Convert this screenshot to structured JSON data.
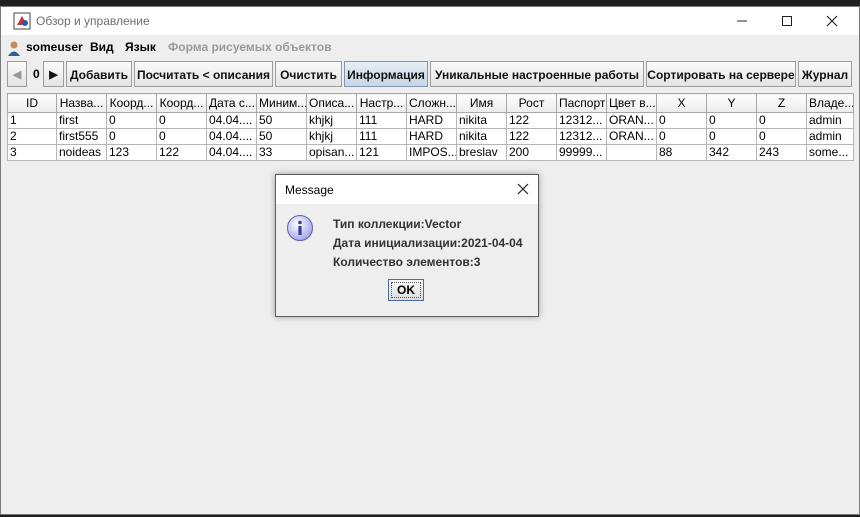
{
  "window": {
    "title": "Обзор и управление"
  },
  "menubar": {
    "user": "someuser",
    "view": "Вид",
    "language": "Язык",
    "shapes_form": "Форма рисуемых объектов"
  },
  "toolbar": {
    "page": "0",
    "add": "Добавить",
    "count": "Посчитать < описания",
    "clear": "Очистить",
    "info": "Информация",
    "unique": "Уникальные настроенные работы",
    "sort": "Сортировать на сервере",
    "log": "Журнал"
  },
  "table": {
    "headers": [
      "ID",
      "Назва...",
      "Коорд...",
      "Коорд...",
      "Дата с...",
      "Миним...",
      "Описа...",
      "Настр...",
      "Сложн...",
      "Имя",
      "Рост",
      "Паспорт",
      "Цвет в...",
      "X",
      "Y",
      "Z",
      "Владе..."
    ],
    "rows": [
      [
        "1",
        "first",
        "0",
        "0",
        "04.04....",
        "50",
        "khjkj",
        "111",
        "HARD",
        "nikita",
        "122",
        "12312...",
        "ORAN...",
        "0",
        "0",
        "0",
        "admin"
      ],
      [
        "2",
        "first555",
        "0",
        "0",
        "04.04....",
        "50",
        "khjkj",
        "111",
        "HARD",
        "nikita",
        "122",
        "12312...",
        "ORAN...",
        "0",
        "0",
        "0",
        "admin"
      ],
      [
        "3",
        "noideas",
        "123",
        "122",
        "04.04....",
        "33",
        "opisan...",
        "121",
        "IMPOS...",
        "breslav",
        "200",
        "99999...",
        "",
        "88",
        "342",
        "243",
        "some..."
      ]
    ]
  },
  "dialog": {
    "title": "Message",
    "line1": "Тип коллекции:Vector",
    "line2": "Дата инициализации:2021-04-04",
    "line3": "Количество элементов:3",
    "ok": "OK"
  }
}
